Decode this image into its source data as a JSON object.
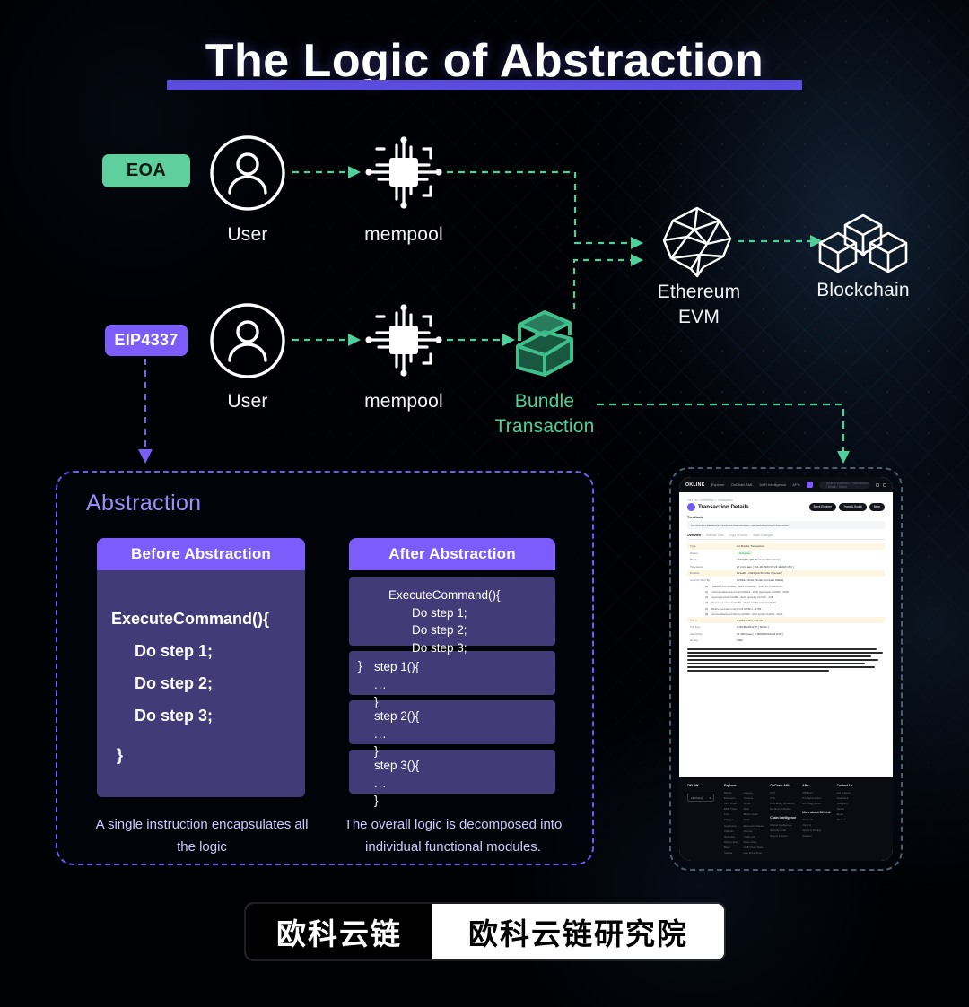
{
  "title": "The Logic of Abstraction",
  "colors": {
    "accent_purple": "#7c5cfa",
    "accent_green": "#5fcf9e",
    "title_underline": "#5b4ce0",
    "background": "#000105",
    "code_body": "#433a78"
  },
  "flow": {
    "row_eoa": {
      "badge": "EOA",
      "user_label": "User",
      "mempool_label": "mempool"
    },
    "row_eip": {
      "badge": "EIP4337",
      "user_label": "User",
      "mempool_label": "mempool",
      "bundle_label_line1": "Bundle",
      "bundle_label_line2": "Transaction"
    },
    "evm_label_line1": "Ethereum",
    "evm_label_line2": "EVM",
    "blockchain_label": "Blockchain"
  },
  "abstraction": {
    "title": "Abstraction",
    "before": {
      "heading": "Before Abstraction",
      "code_l1": "ExecuteCommand(){",
      "code_l2": "Do step 1;",
      "code_l3": "Do step 2;",
      "code_l4": "Do step 3;",
      "code_l5": "}",
      "caption": "A single instruction encapsulates all the logic"
    },
    "after": {
      "heading": "After Abstraction",
      "main": {
        "l1": "ExecuteCommand(){",
        "l2": "Do step 1;",
        "l3": "Do step 2;",
        "l4": "Do step 3;",
        "l5": "}"
      },
      "steps": [
        {
          "sig": "step 1(){",
          "dots": "...",
          "close": "}"
        },
        {
          "sig": "step 2(){",
          "dots": "...",
          "close": "}"
        },
        {
          "sig": "step 3(){",
          "dots": "...",
          "close": "}"
        }
      ],
      "caption": "The overall logic is decomposed into individual functional modules."
    }
  },
  "tablet": {
    "nav": {
      "logo": "OKLINK",
      "items": [
        "Explorer",
        "OnChain AML",
        "DeFi Intelligence",
        "APIs"
      ],
      "search_placeholder": "Search Address / Transaction / Block / Token",
      "icons": [
        "grid-icon",
        "user-icon"
      ]
    },
    "page": {
      "breadcrumb": "OKLink  >  Ethereum  >  Transaction",
      "heading": "Transaction Details",
      "buttons": [
        "Block Explorer",
        "Trace & Social",
        "More"
      ],
      "hash_label": "Txn Hash",
      "hash_value": "0xb3c4e18f19ab8b2ca1c194cd81c8ad49b2a2f85b6ed2d0f0a2c9a7b33a1d0f4e",
      "tabs": [
        "Overview",
        "Internal Txns",
        "Logs / Events",
        "State Changes"
      ],
      "rows": [
        {
          "k": "Txn Hash",
          "v": "0xb3c4e18f19ab8b2c…",
          "hl": false
        },
        {
          "k": "Type",
          "v": "AA Bundle Transaction",
          "hl": true
        },
        {
          "k": "Status",
          "v": "Success",
          "hl": false,
          "pill": true
        },
        {
          "k": "Block",
          "v": "18374921   (56 Block Confirmations)",
          "hl": false
        },
        {
          "k": "Timestamp",
          "v": "27 mins ago  ( Oct-18-2023 09:21:11 AM UTC )",
          "hl": false
        },
        {
          "k": "Bundler",
          "v": "0x1a2b…c3d4  (AA Bundler Operator)",
          "hl": true
        },
        {
          "k": "UserOp Sent By",
          "v": "0x4f9a…8e21   (Smart Contract Wallet)",
          "hl": false
        },
        {
          "k": "Interacted With",
          "v": "EntryPoint v0.6  0x5FF137D4b0FDCD49DcA30c7CF57E578a026d2789",
          "hl": false
        },
        {
          "k": "Value",
          "v": "0.0254 ETH  ( $41.28 )",
          "hl": true
        },
        {
          "k": "Txn Fee",
          "v": "0.00186245 ETH  ( $3.02 )",
          "hl": false
        },
        {
          "k": "Gas Price",
          "v": "21.384 Gwei  ( 0.000000021384 ETH )",
          "hl": false
        },
        {
          "k": "Nonce",
          "v": "1382",
          "hl": false
        }
      ],
      "log_lines": [
        {
          "idx": "[0]",
          "v": "Transfer   from 0x4f9a…8e21   to 0xb12c…7d93   for 0.0254 ETH"
        },
        {
          "idx": "[1]",
          "v": "UserOperationEvent   hash 0x8fa1…29c0   paymaster 0x0000…0000"
        },
        {
          "idx": "[2]",
          "v": "Approval   owner 0x4f9a…8e21   spender 0x7a16…d4f8"
        },
        {
          "idx": "[3]",
          "v": "Deposited   account 0x4f9a…8e21   totalDeposit 0.12 ETH"
        },
        {
          "idx": "[4]",
          "v": "BeforeExecution   entryPoint 0x5FF1…2789"
        },
        {
          "idx": "[5]",
          "v": "AccountDeployed   factory 0x9406…f0b2   sender 0x4f9a…8e21"
        }
      ]
    },
    "footer": {
      "logo": "OKLINK",
      "select": "All Chains",
      "columns": [
        {
          "head": "Explorer",
          "links": [
            "Bitcoin",
            "Ethereum",
            "OKT Chain",
            "BNB Chain",
            "Tron",
            "Polygon",
            "Avalanche",
            "Arbitrum",
            "Optimism",
            "zkSync Era",
            "Base",
            "Solana"
          ]
        },
        {
          "head": "",
          "links": [
            "Litecoin",
            "Cosmos",
            "Aptos",
            "Near",
            "Bitcoin Cash",
            "Dash",
            "Ethereum Classic",
            "Filecoin",
            "Chain List",
            "Dune Chart",
            "OKB Chain Data",
            "Gas Price Tools"
          ]
        },
        {
          "head": "OnChain AML",
          "links": [
            "KYT",
            "KYA",
            "Risk Entity Screening",
            "De-anonymization",
            "Chain Intelligence",
            "Market Intelligence",
            "Security Audit",
            "Report a Scam"
          ]
        },
        {
          "head": "APIs",
          "links": [
            "API Docs",
            "Pro Subscription",
            "API Playground",
            "More about OKLink",
            "About Us",
            "Join Us",
            "Terms & Privacy",
            "Careers"
          ]
        },
        {
          "head": "Contact Us",
          "links": [
            "Get Support",
            "Feedback",
            "Telegram",
            "Twitter",
            "Email",
            "Discord"
          ]
        }
      ]
    }
  },
  "footer_logo": {
    "left": "欧科云链",
    "right": "欧科云链研究院"
  }
}
